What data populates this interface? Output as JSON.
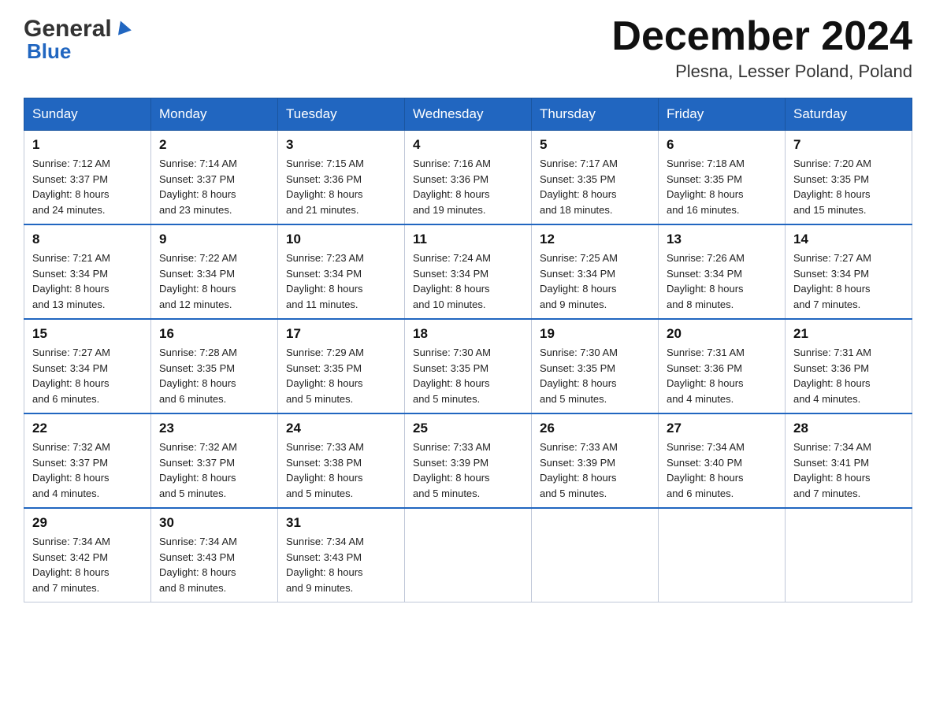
{
  "header": {
    "logo_general": "General",
    "logo_blue": "Blue",
    "month_title": "December 2024",
    "location": "Plesna, Lesser Poland, Poland"
  },
  "weekdays": [
    "Sunday",
    "Monday",
    "Tuesday",
    "Wednesday",
    "Thursday",
    "Friday",
    "Saturday"
  ],
  "weeks": [
    [
      {
        "day": "1",
        "sunrise": "7:12 AM",
        "sunset": "3:37 PM",
        "daylight": "8 hours and 24 minutes."
      },
      {
        "day": "2",
        "sunrise": "7:14 AM",
        "sunset": "3:37 PM",
        "daylight": "8 hours and 23 minutes."
      },
      {
        "day": "3",
        "sunrise": "7:15 AM",
        "sunset": "3:36 PM",
        "daylight": "8 hours and 21 minutes."
      },
      {
        "day": "4",
        "sunrise": "7:16 AM",
        "sunset": "3:36 PM",
        "daylight": "8 hours and 19 minutes."
      },
      {
        "day": "5",
        "sunrise": "7:17 AM",
        "sunset": "3:35 PM",
        "daylight": "8 hours and 18 minutes."
      },
      {
        "day": "6",
        "sunrise": "7:18 AM",
        "sunset": "3:35 PM",
        "daylight": "8 hours and 16 minutes."
      },
      {
        "day": "7",
        "sunrise": "7:20 AM",
        "sunset": "3:35 PM",
        "daylight": "8 hours and 15 minutes."
      }
    ],
    [
      {
        "day": "8",
        "sunrise": "7:21 AM",
        "sunset": "3:34 PM",
        "daylight": "8 hours and 13 minutes."
      },
      {
        "day": "9",
        "sunrise": "7:22 AM",
        "sunset": "3:34 PM",
        "daylight": "8 hours and 12 minutes."
      },
      {
        "day": "10",
        "sunrise": "7:23 AM",
        "sunset": "3:34 PM",
        "daylight": "8 hours and 11 minutes."
      },
      {
        "day": "11",
        "sunrise": "7:24 AM",
        "sunset": "3:34 PM",
        "daylight": "8 hours and 10 minutes."
      },
      {
        "day": "12",
        "sunrise": "7:25 AM",
        "sunset": "3:34 PM",
        "daylight": "8 hours and 9 minutes."
      },
      {
        "day": "13",
        "sunrise": "7:26 AM",
        "sunset": "3:34 PM",
        "daylight": "8 hours and 8 minutes."
      },
      {
        "day": "14",
        "sunrise": "7:27 AM",
        "sunset": "3:34 PM",
        "daylight": "8 hours and 7 minutes."
      }
    ],
    [
      {
        "day": "15",
        "sunrise": "7:27 AM",
        "sunset": "3:34 PM",
        "daylight": "8 hours and 6 minutes."
      },
      {
        "day": "16",
        "sunrise": "7:28 AM",
        "sunset": "3:35 PM",
        "daylight": "8 hours and 6 minutes."
      },
      {
        "day": "17",
        "sunrise": "7:29 AM",
        "sunset": "3:35 PM",
        "daylight": "8 hours and 5 minutes."
      },
      {
        "day": "18",
        "sunrise": "7:30 AM",
        "sunset": "3:35 PM",
        "daylight": "8 hours and 5 minutes."
      },
      {
        "day": "19",
        "sunrise": "7:30 AM",
        "sunset": "3:35 PM",
        "daylight": "8 hours and 5 minutes."
      },
      {
        "day": "20",
        "sunrise": "7:31 AM",
        "sunset": "3:36 PM",
        "daylight": "8 hours and 4 minutes."
      },
      {
        "day": "21",
        "sunrise": "7:31 AM",
        "sunset": "3:36 PM",
        "daylight": "8 hours and 4 minutes."
      }
    ],
    [
      {
        "day": "22",
        "sunrise": "7:32 AM",
        "sunset": "3:37 PM",
        "daylight": "8 hours and 4 minutes."
      },
      {
        "day": "23",
        "sunrise": "7:32 AM",
        "sunset": "3:37 PM",
        "daylight": "8 hours and 5 minutes."
      },
      {
        "day": "24",
        "sunrise": "7:33 AM",
        "sunset": "3:38 PM",
        "daylight": "8 hours and 5 minutes."
      },
      {
        "day": "25",
        "sunrise": "7:33 AM",
        "sunset": "3:39 PM",
        "daylight": "8 hours and 5 minutes."
      },
      {
        "day": "26",
        "sunrise": "7:33 AM",
        "sunset": "3:39 PM",
        "daylight": "8 hours and 5 minutes."
      },
      {
        "day": "27",
        "sunrise": "7:34 AM",
        "sunset": "3:40 PM",
        "daylight": "8 hours and 6 minutes."
      },
      {
        "day": "28",
        "sunrise": "7:34 AM",
        "sunset": "3:41 PM",
        "daylight": "8 hours and 7 minutes."
      }
    ],
    [
      {
        "day": "29",
        "sunrise": "7:34 AM",
        "sunset": "3:42 PM",
        "daylight": "8 hours and 7 minutes."
      },
      {
        "day": "30",
        "sunrise": "7:34 AM",
        "sunset": "3:43 PM",
        "daylight": "8 hours and 8 minutes."
      },
      {
        "day": "31",
        "sunrise": "7:34 AM",
        "sunset": "3:43 PM",
        "daylight": "8 hours and 9 minutes."
      },
      null,
      null,
      null,
      null
    ]
  ],
  "labels": {
    "sunrise": "Sunrise:",
    "sunset": "Sunset:",
    "daylight": "Daylight:"
  }
}
